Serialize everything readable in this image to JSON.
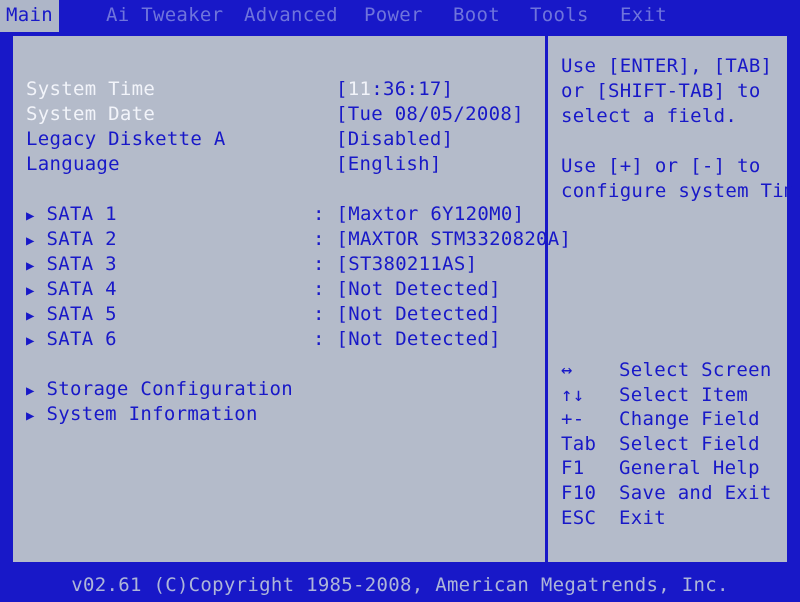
{
  "menu": {
    "tabs": [
      {
        "label": "Main"
      },
      {
        "label": "Ai Tweaker"
      },
      {
        "label": "Advanced"
      },
      {
        "label": "Power"
      },
      {
        "label": "Boot"
      },
      {
        "label": "Tools"
      },
      {
        "label": "Exit"
      }
    ]
  },
  "main": {
    "system_time": {
      "label": "System Time",
      "open": "[",
      "hl": "11",
      "rest": ":36:17]"
    },
    "system_date": {
      "label": "System Date",
      "value": "[Tue 08/05/2008]"
    },
    "legacy_diskette": {
      "label": "Legacy Diskette A",
      "value": "[Disabled]"
    },
    "language": {
      "label": "Language",
      "value": "[English]"
    },
    "sata": [
      {
        "label": "SATA 1",
        "value": "[Maxtor 6Y120M0]"
      },
      {
        "label": "SATA 2",
        "value": "[MAXTOR STM3320820A]"
      },
      {
        "label": "SATA 3",
        "value": "[ST380211AS]"
      },
      {
        "label": "SATA 4",
        "value": "[Not Detected]"
      },
      {
        "label": "SATA 5",
        "value": "[Not Detected]"
      },
      {
        "label": "SATA 6",
        "value": "[Not Detected]"
      }
    ],
    "separator": ":",
    "caret": "▶",
    "submenus": [
      {
        "label": "Storage Configuration"
      },
      {
        "label": "System Information"
      }
    ]
  },
  "help": {
    "lines1": [
      "Use [ENTER], [TAB]",
      "or [SHIFT-TAB] to",
      "select a field."
    ],
    "lines2": [
      "Use [+] or [-] to",
      "configure system Time."
    ],
    "keys": [
      {
        "key": "↔",
        "desc": "Select Screen"
      },
      {
        "key": "↑↓",
        "desc": "Select Item"
      },
      {
        "key": "+-",
        "desc": "Change Field"
      },
      {
        "key": "Tab",
        "desc": "Select Field"
      },
      {
        "key": "F1",
        "desc": "General Help"
      },
      {
        "key": "F10",
        "desc": "Save and Exit"
      },
      {
        "key": "ESC",
        "desc": "Exit"
      }
    ]
  },
  "footer": {
    "text": "v02.61 (C)Copyright 1985-2008, American Megatrends, Inc."
  }
}
